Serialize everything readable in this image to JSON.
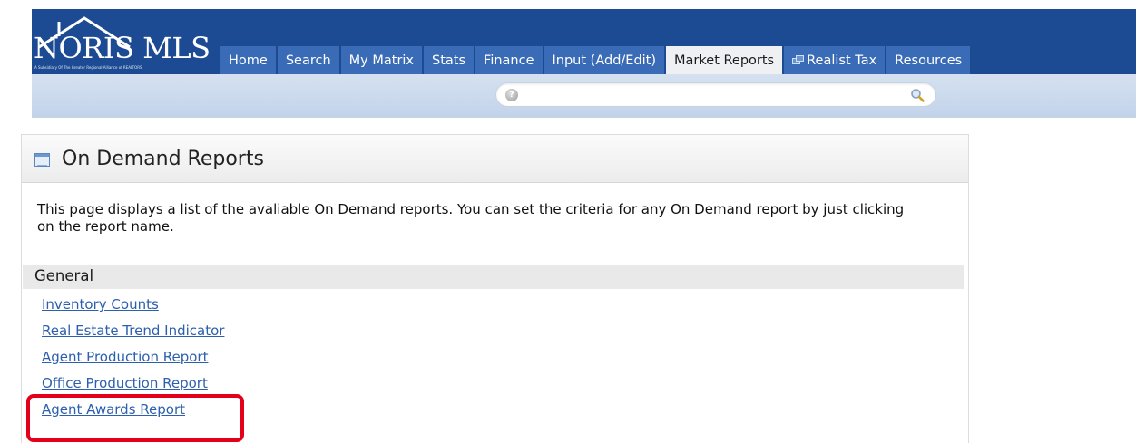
{
  "header": {
    "logo_text": "NORIS MLS",
    "logo_subtext": "A Subsidiary Of The Greater Regional Alliance of REALTORS",
    "brand_color": "#1c4a93",
    "tab_color": "#3a6bb6",
    "nav_tabs": [
      {
        "label": "Home"
      },
      {
        "label": "Search"
      },
      {
        "label": "My Matrix"
      },
      {
        "label": "Stats"
      },
      {
        "label": "Finance"
      },
      {
        "label": "Input (Add/Edit)"
      },
      {
        "label": "Market Reports",
        "active": true
      },
      {
        "label": "Realist Tax",
        "icon": "external-window-icon"
      },
      {
        "label": "Resources"
      }
    ]
  },
  "search": {
    "value": "",
    "help_icon": "help-icon",
    "search_icon": "magnifier-icon"
  },
  "panel": {
    "icon": "report-icon",
    "title": "On Demand Reports",
    "description": "This page displays a list of the avaliable On Demand reports. You can set the criteria for any On Demand report by just clicking on the report name."
  },
  "sections": [
    {
      "title": "General",
      "reports": [
        {
          "label": "Inventory Counts"
        },
        {
          "label": "Real Estate Trend Indicator"
        },
        {
          "label": "Agent Production Report"
        },
        {
          "label": "Office Production Report"
        },
        {
          "label": "Agent Awards Report",
          "highlighted": true
        }
      ]
    }
  ],
  "annotation": {
    "highlight_color": "#e4001b"
  }
}
